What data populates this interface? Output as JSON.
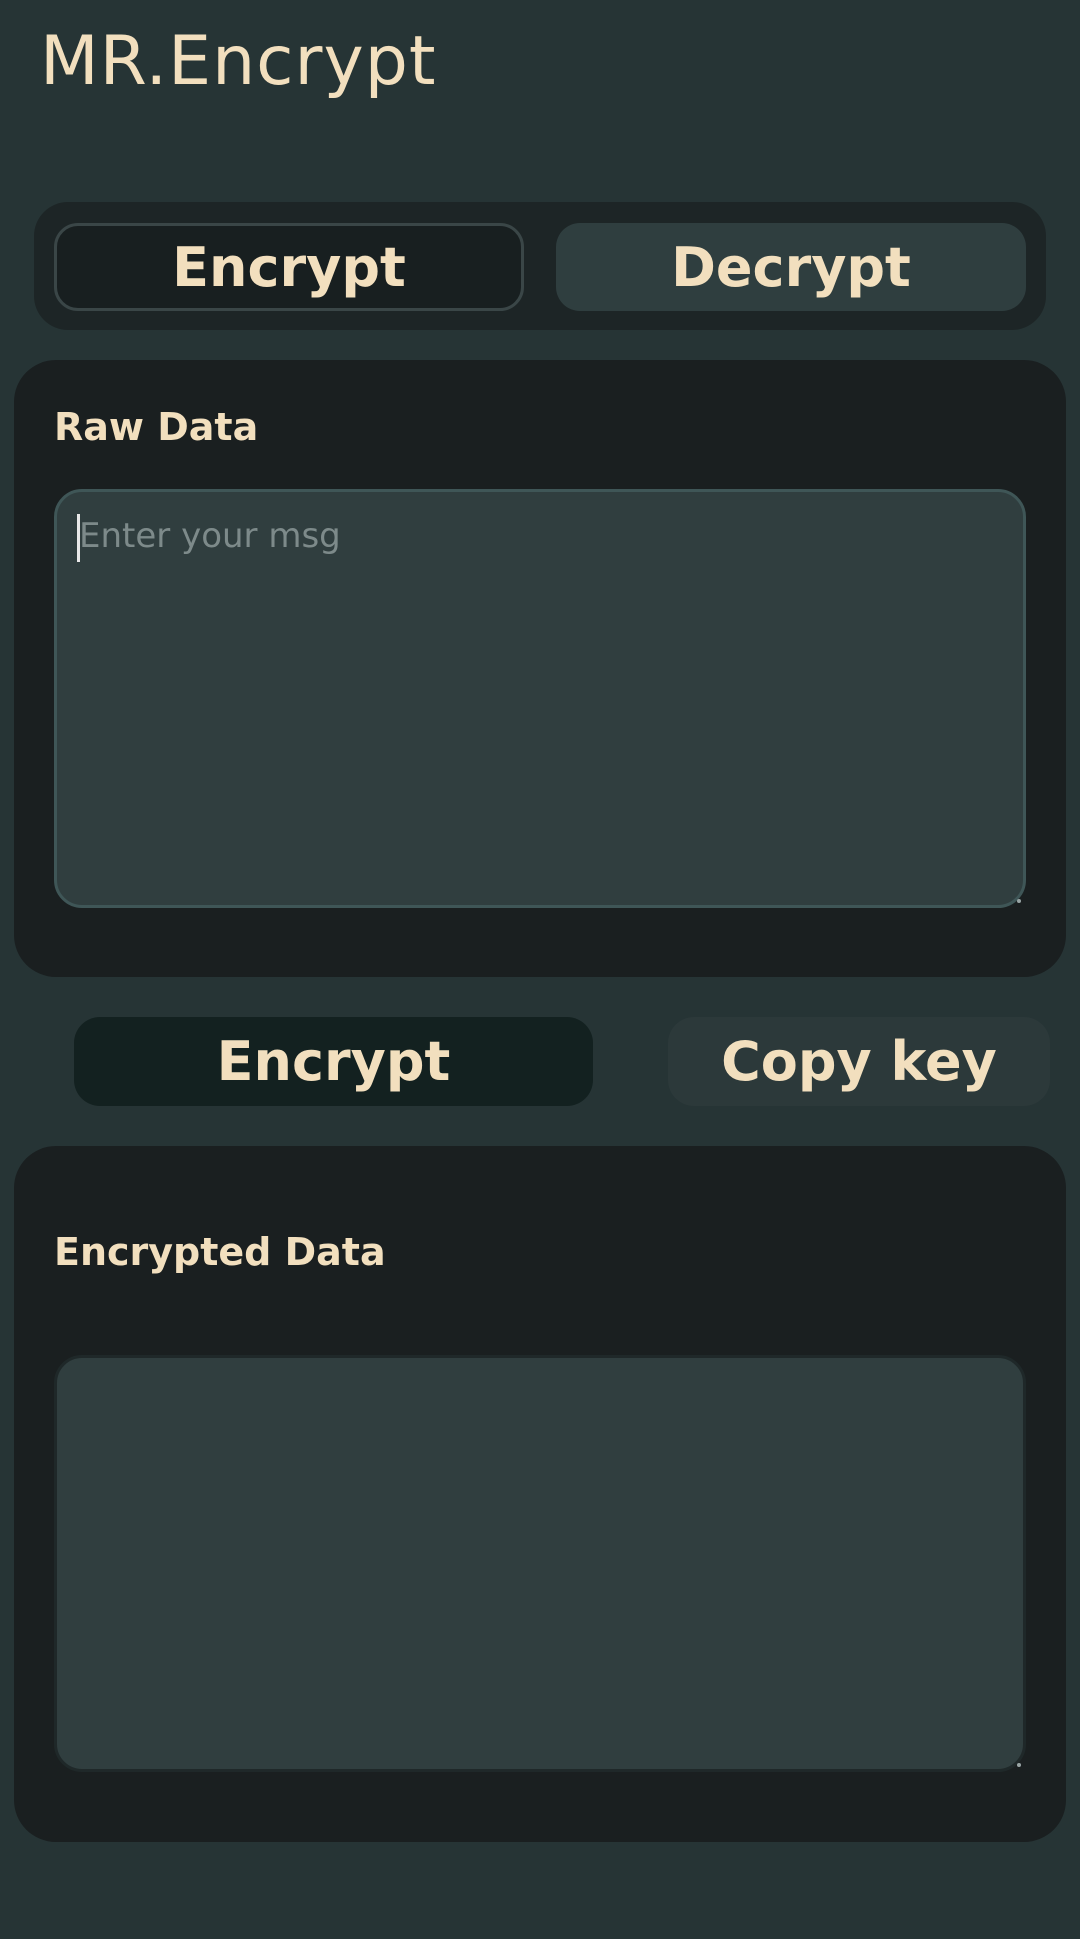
{
  "app": {
    "title": "MR.Encrypt"
  },
  "mode_switch": {
    "encrypt_label": "Encrypt",
    "decrypt_label": "Decrypt",
    "active": "Encrypt"
  },
  "raw_section": {
    "label": "Raw Data",
    "input_placeholder": "Enter your msg",
    "input_value": ""
  },
  "actions": {
    "encrypt_label": "Encrypt",
    "copy_key_label": "Copy key"
  },
  "encrypted_section": {
    "label": "Encrypted Data",
    "output_value": ""
  },
  "colors": {
    "background": "#263435",
    "card": "#1a1f20",
    "accent_text": "#f2dfbe",
    "input_fill": "#303e3f"
  }
}
